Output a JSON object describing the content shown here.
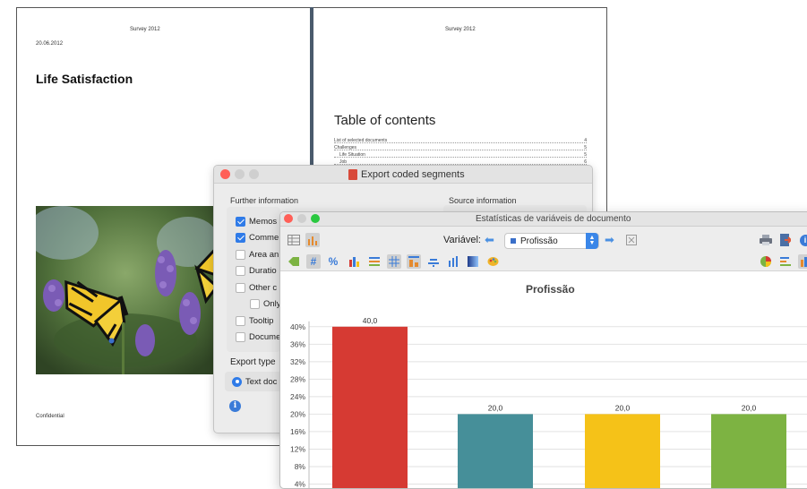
{
  "doc": {
    "page1": {
      "header": "Survey 2012",
      "date": "20.06.2012",
      "title": "Life Satisfaction",
      "footer": "Confidential"
    },
    "page2": {
      "header": "Survey 2012",
      "toc_title": "Table of contents",
      "toc_entries": [
        {
          "label": "List of selected documents",
          "page": "4"
        },
        {
          "label": "Challenges",
          "page": "5"
        },
        {
          "label": "Life Situation",
          "page": "5"
        },
        {
          "label": "Job",
          "page": "6"
        }
      ]
    }
  },
  "export_dialog": {
    "title": "Export coded segments",
    "further_info_label": "Further information",
    "source_info_label": "Source information",
    "options": [
      {
        "label": "Memos",
        "checked": true
      },
      {
        "label": "Comme",
        "checked": true
      },
      {
        "label": "Area an",
        "checked": false
      },
      {
        "label": "Duratio",
        "checked": false
      },
      {
        "label": "Other c",
        "checked": false
      },
      {
        "label": "Only",
        "checked": false
      },
      {
        "label": "Tooltip",
        "checked": false
      },
      {
        "label": "Docume",
        "checked": false
      }
    ],
    "export_type_label": "Export type",
    "export_type_option": "Text doc"
  },
  "stats_window": {
    "title": "Estatísticas de variáveis de documento",
    "variable_label": "Variável:",
    "variable_value": "Profissão"
  },
  "chart_data": {
    "type": "bar",
    "title": "Profissão",
    "values": [
      40.0,
      20.0,
      20.0,
      20.0
    ],
    "data_labels": [
      "40,0",
      "20,0",
      "20,0",
      "20,0"
    ],
    "colors": [
      "#d63a33",
      "#468f99",
      "#f5c218",
      "#7db342"
    ],
    "y_ticks": [
      "4%",
      "8%",
      "12%",
      "16%",
      "20%",
      "24%",
      "28%",
      "32%",
      "36%",
      "40%"
    ],
    "ylim": [
      0,
      40
    ],
    "grid": true
  }
}
